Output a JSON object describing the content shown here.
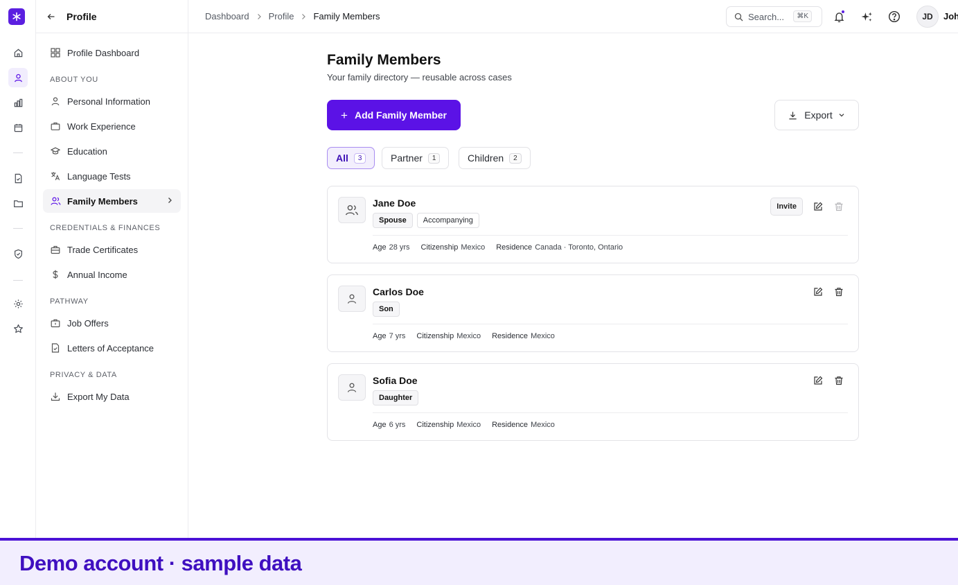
{
  "colors": {
    "accent": "#5b12e6",
    "banner_text": "#3f0fc0"
  },
  "rail": {
    "icons": [
      "logo-icon",
      "home-icon",
      "user-icon",
      "chart-icon",
      "calendar-icon",
      "document-check-icon",
      "folder-icon",
      "shield-check-icon",
      "gear-icon",
      "star-icon"
    ]
  },
  "sidebar": {
    "title": "Profile",
    "dashboard": "Profile Dashboard",
    "sections": {
      "about": "ABOUT YOU",
      "credentials": "CREDENTIALS & FINANCES",
      "pathway": "PATHWAY",
      "privacy": "PRIVACY & DATA"
    },
    "items": {
      "personal": "Personal Information",
      "work": "Work Experience",
      "education": "Education",
      "language": "Language Tests",
      "family": "Family Members",
      "trade": "Trade Certificates",
      "income": "Annual Income",
      "jobs": "Job Offers",
      "letters": "Letters of Acceptance",
      "export": "Export My Data"
    }
  },
  "topbar": {
    "breadcrumb": [
      "Dashboard",
      "Profile",
      "Family Members"
    ],
    "search_placeholder": "Search...",
    "search_shortcut": "⌘K",
    "avatar_initials": "JD",
    "user_name": "John"
  },
  "main": {
    "title": "Family Members",
    "subtitle": "Your family directory — reusable across cases",
    "add_button": "Add Family Member",
    "export_button": "Export",
    "tabs": [
      {
        "label": "All",
        "count": "3"
      },
      {
        "label": "Partner",
        "count": "1"
      },
      {
        "label": "Children",
        "count": "2"
      }
    ],
    "members": [
      {
        "name": "Jane Doe",
        "relation": "Spouse",
        "status": "Accompanying",
        "age_label": "Age",
        "age": "28 yrs",
        "citizenship_label": "Citizenship",
        "citizenship": "Mexico",
        "residence_label": "Residence",
        "residence": "Canada · Toronto, Ontario",
        "invite": "Invite"
      },
      {
        "name": "Carlos Doe",
        "relation": "Son",
        "age_label": "Age",
        "age": "7 yrs",
        "citizenship_label": "Citizenship",
        "citizenship": "Mexico",
        "residence_label": "Residence",
        "residence": "Mexico"
      },
      {
        "name": "Sofia Doe",
        "relation": "Daughter",
        "age_label": "Age",
        "age": "6 yrs",
        "citizenship_label": "Citizenship",
        "citizenship": "Mexico",
        "residence_label": "Residence",
        "residence": "Mexico"
      }
    ]
  },
  "banner": {
    "text": "Demo account · sample data"
  }
}
